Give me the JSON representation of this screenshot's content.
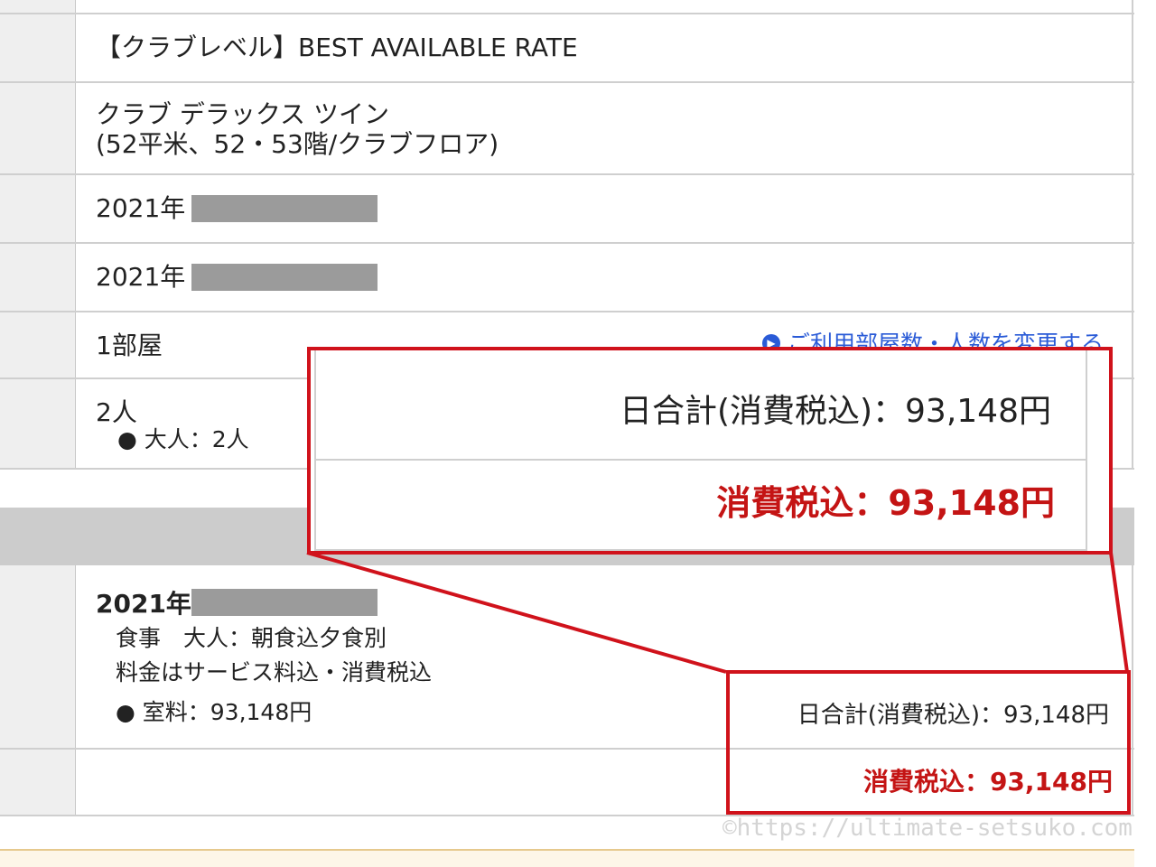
{
  "plan": {
    "rate_name": "【クラブレベル】BEST AVAILABLE RATE",
    "room_type": "クラブ デラックス ツイン",
    "room_detail": "(52平米、52・53階/クラブフロア)",
    "checkin_year": "2021年",
    "checkout_year": "2021年",
    "rooms": "1部屋",
    "change_link": "ご利用部屋数・人数を変更する",
    "guests": "2人",
    "guests_detail": "● 大人：2人"
  },
  "day_detail": {
    "year": "2021年",
    "meal": "食事　大人：朝食込夕食別",
    "fee_note": "料金はサービス料込・消費税込",
    "room_fee": "● 室料：93,148円",
    "day_total": "日合計(消費税込)：93,148円",
    "grand_total": "消費税込：93,148円"
  },
  "zoom": {
    "day_total": "日合計(消費税込)：93,148円",
    "grand_total": "消費税込：93,148円"
  },
  "watermark": "©https://ultimate-setsuko.com",
  "colors": {
    "highlight": "#d0121b",
    "price_red": "#c41414",
    "link": "#2a5bd7"
  }
}
